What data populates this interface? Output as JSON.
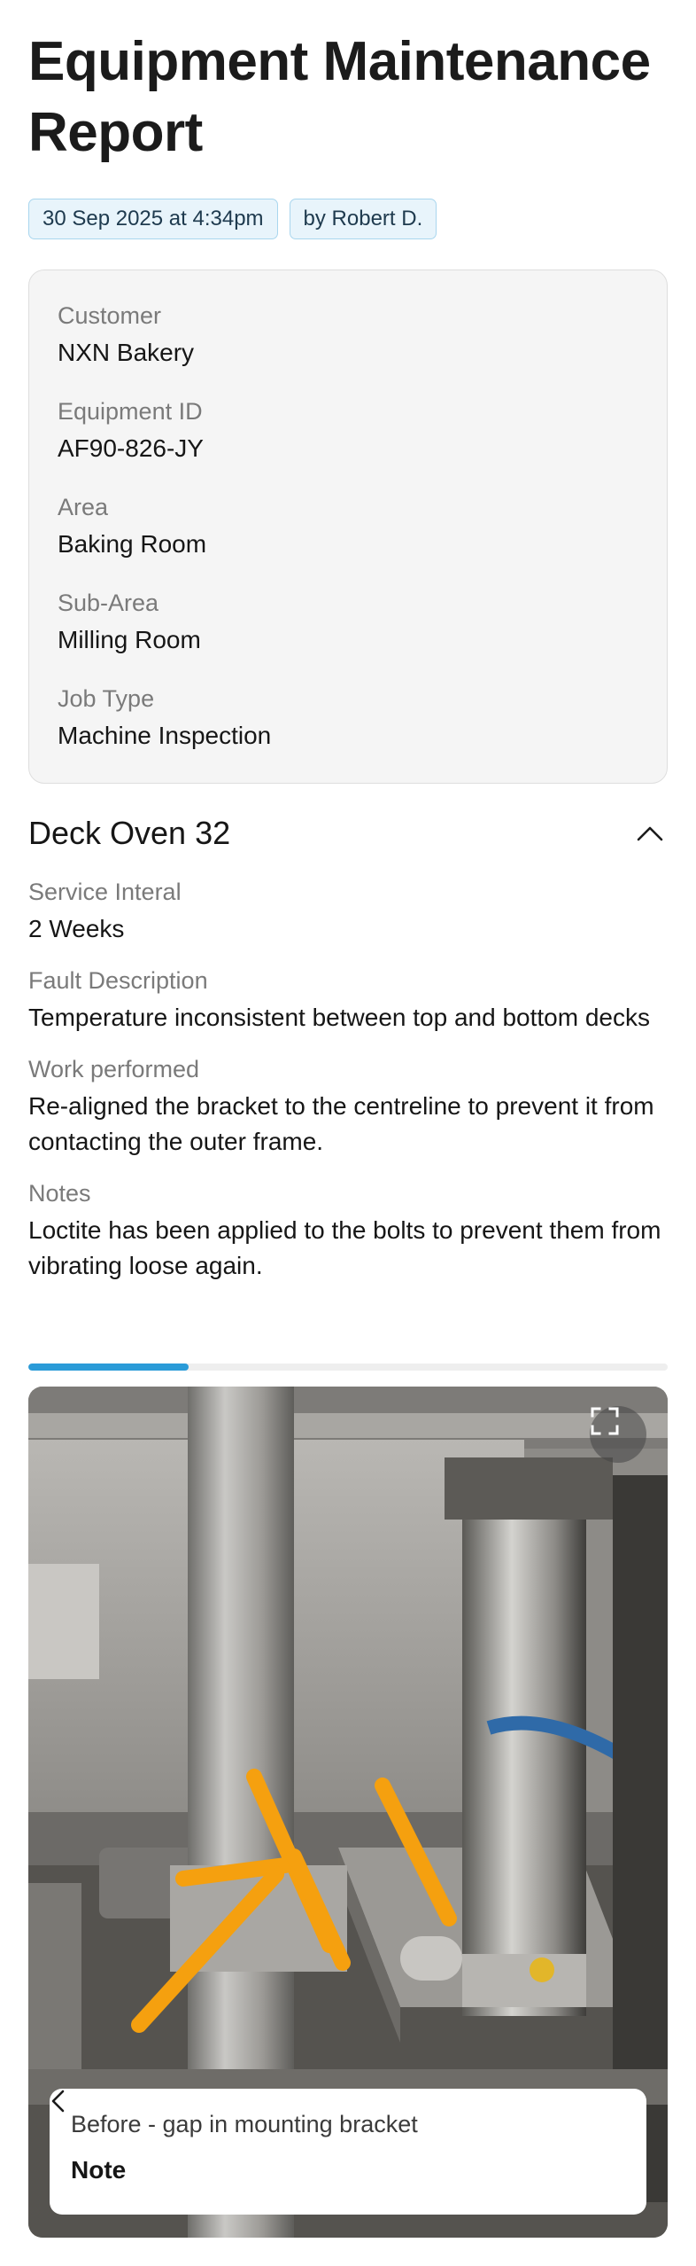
{
  "report": {
    "title": "Equipment Maintenance Report",
    "date_badge": "30 Sep 2025 at 4:34pm",
    "author_badge": "by Robert D."
  },
  "info": {
    "customer_label": "Customer",
    "customer_value": "NXN Bakery",
    "equipment_label": "Equipment ID",
    "equipment_value": "AF90-826-JY",
    "area_label": "Area",
    "area_value": "Baking Room",
    "subarea_label": "Sub-Area",
    "subarea_value": "Milling Room",
    "jobtype_label": "Job Type",
    "jobtype_value": "Machine Inspection"
  },
  "section": {
    "title": "Deck Oven 32",
    "collapse_icon": "chevron-up-icon",
    "service_label": "Service Interal",
    "service_value": "2 Weeks",
    "fault_label": "Fault Description",
    "fault_value": "Temperature inconsistent between top and bottom decks",
    "work_label": "Work performed",
    "work_value": "Re-aligned the bracket to the centreline to prevent it from contacting the outer frame.",
    "notes_label": "Notes",
    "notes_value": "Loctite has been applied to the bolts to prevent them from vibrating loose again."
  },
  "gallery": {
    "progress_fraction": 0.25,
    "expand_icon": "expand-icon",
    "caption": "Before - gap in mounting bracket",
    "note_label": "Note",
    "note_icon": "chevron-left-icon",
    "accent_color": "#2a9bd8",
    "annotation_color": "#f5a00f"
  }
}
